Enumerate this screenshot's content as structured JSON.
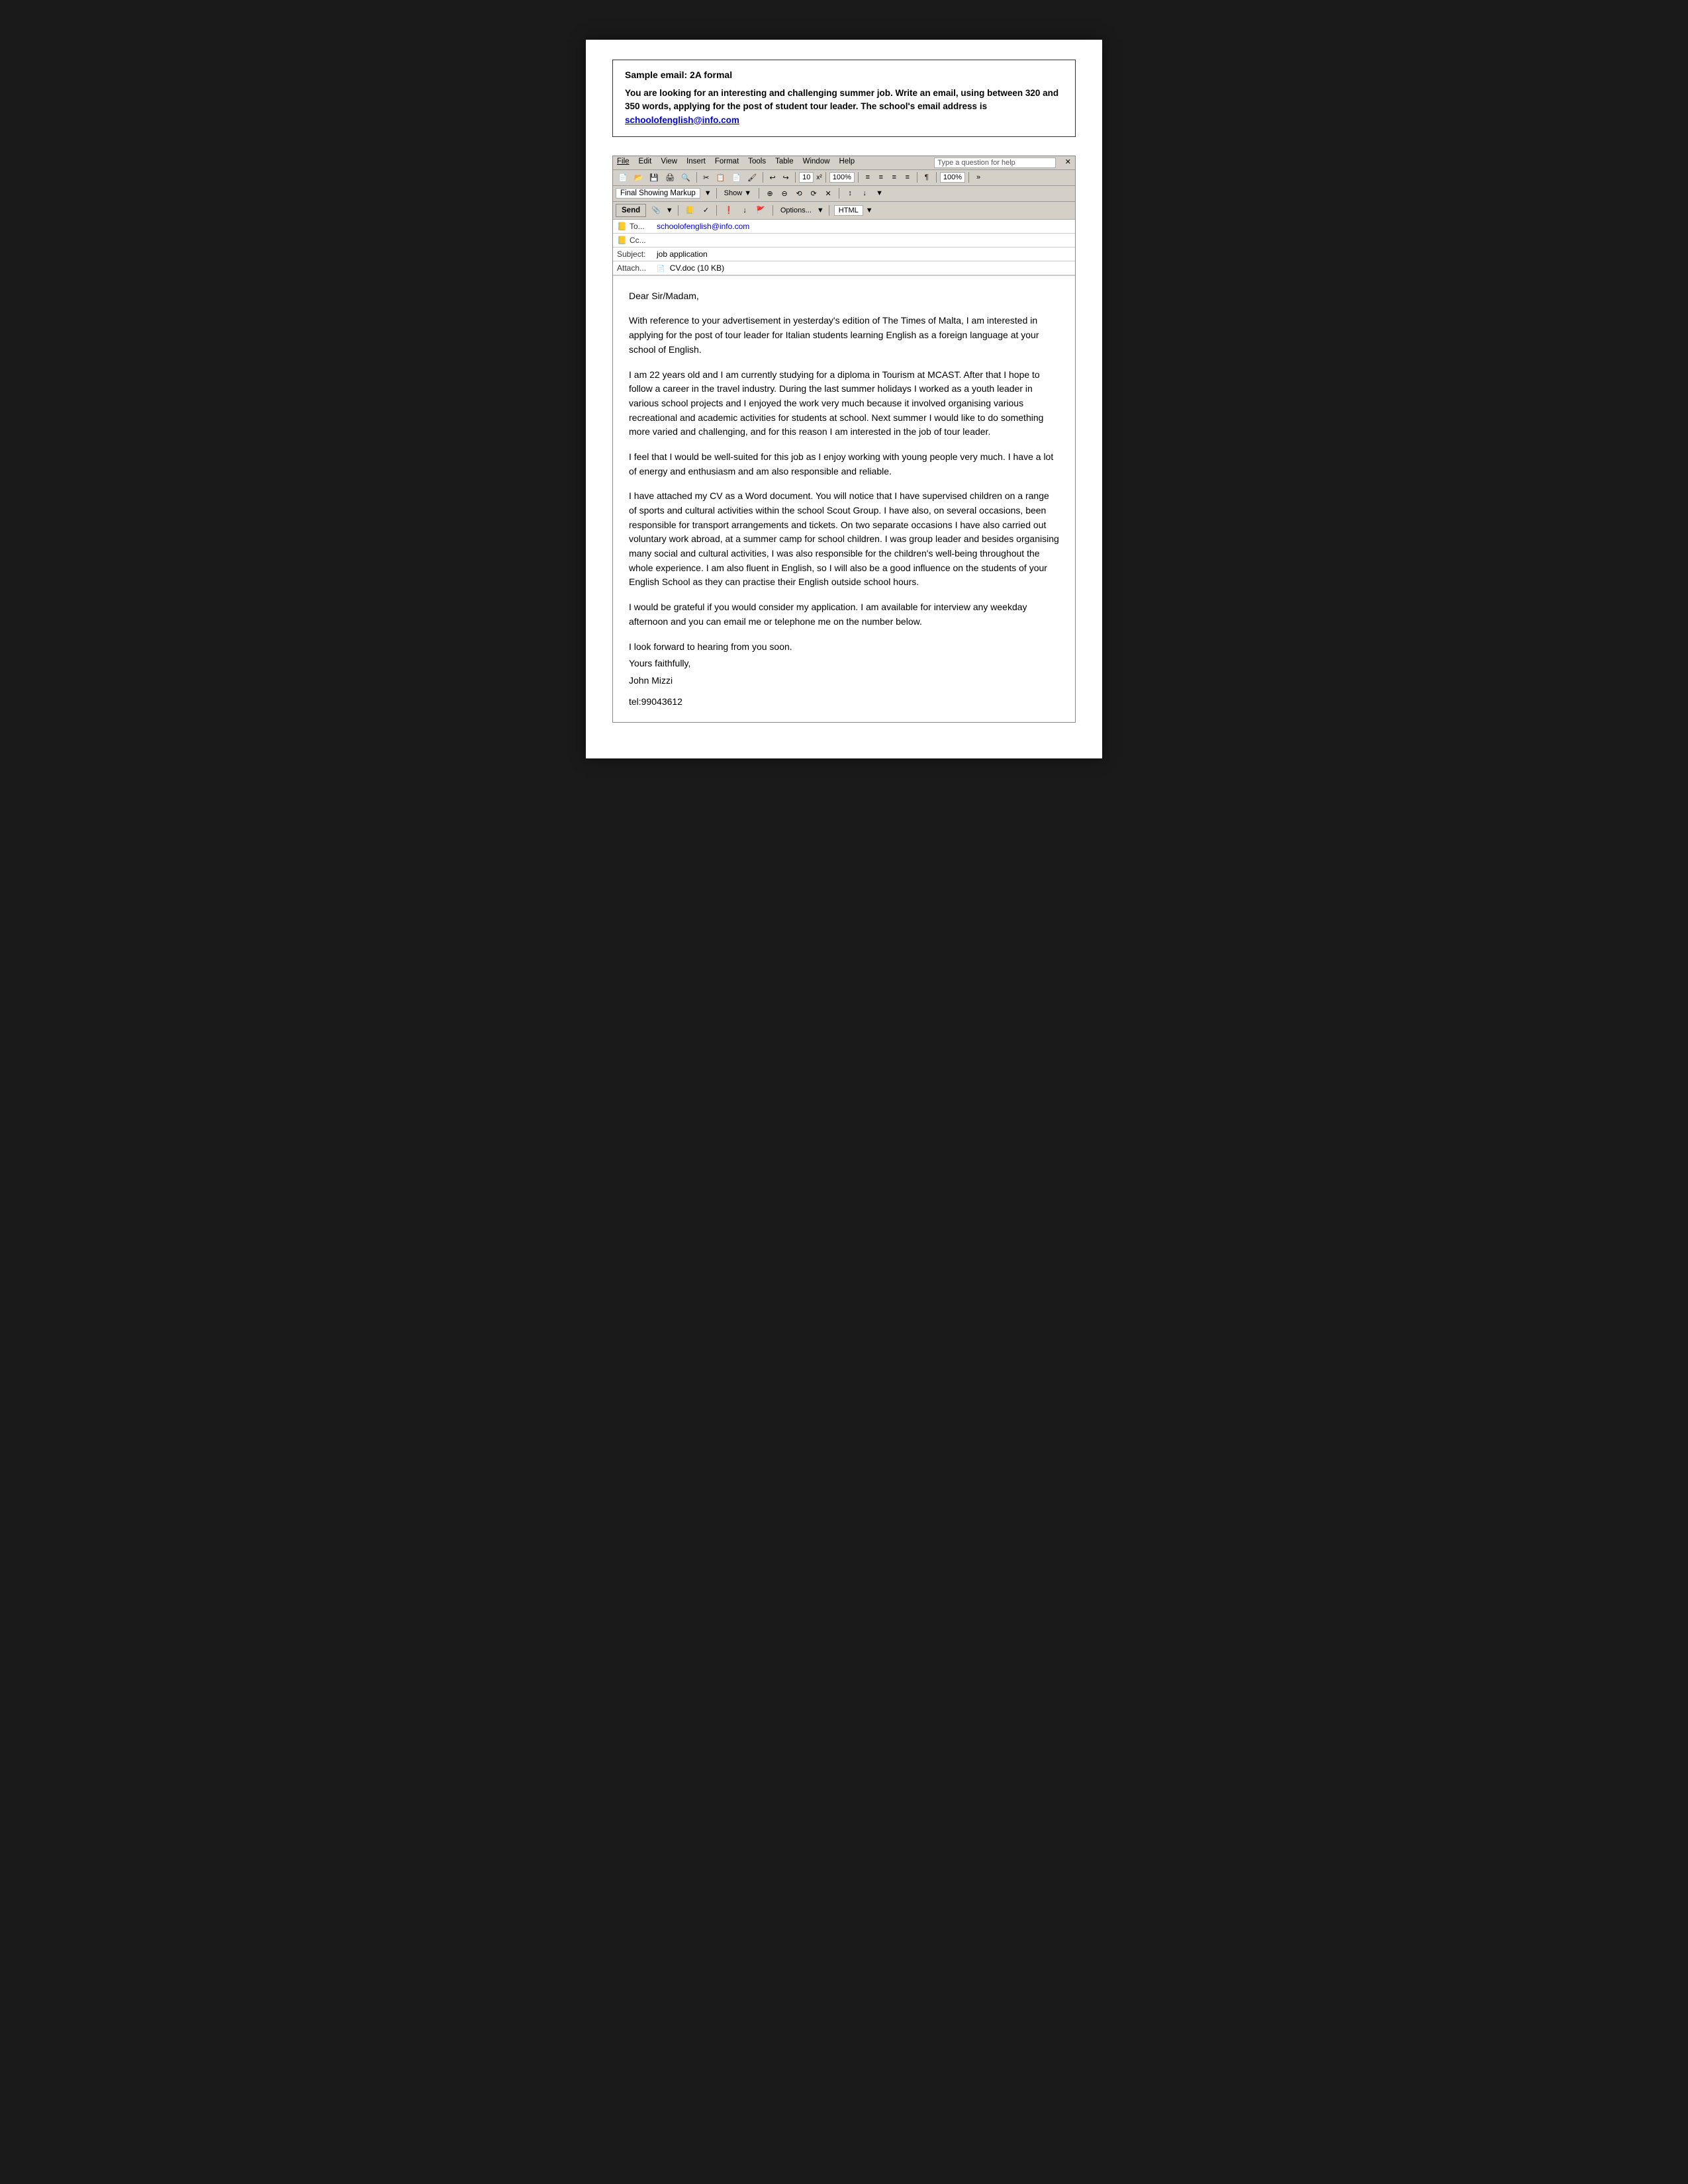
{
  "sample": {
    "title": "Sample email: 2A formal",
    "prompt": "You are looking for an interesting and challenging summer job.  Write an email, using between 320 and 350 words, applying for the post of student tour leader.  The school's email address is ",
    "email_link": "schoolofenglish@info.com"
  },
  "email_client": {
    "menu": {
      "file": "File",
      "edit": "Edit",
      "view": "View",
      "insert": "Insert",
      "format": "Format",
      "tools": "Tools",
      "table": "Table",
      "window": "Window",
      "help": "Help"
    },
    "help_placeholder": "Type a question for help",
    "toolbar1": {
      "buttons": [
        "🖫",
        "🖨",
        "📄",
        "✂",
        "📋",
        "🔍",
        "↩",
        "↪",
        "10",
        "x²",
        "100%",
        "≡",
        "≡",
        "≡",
        "≡",
        "¶",
        "100%"
      ]
    },
    "format_toolbar": {
      "markup_label": "Final Showing Markup",
      "show_label": "Show ▼"
    },
    "compose_toolbar": {
      "send_label": "Send",
      "options_label": "Options...",
      "format_label": "HTML"
    },
    "fields": {
      "to_label": "To...",
      "to_value": "schoolofenglish@info.com",
      "cc_label": "Cc...",
      "cc_value": "",
      "subject_label": "Subject:",
      "subject_value": "job application",
      "attach_label": "Attach...",
      "attach_value": "CV.doc (10 KB)"
    }
  },
  "email_body": {
    "salutation": "Dear Sir/Madam,",
    "paragraph1": "With reference to your advertisement in yesterday's edition of The Times of Malta, I am interested in applying for the post of tour leader for Italian students learning English as a foreign language at your school of English.",
    "paragraph2": "I am 22 years old and I am currently studying for a diploma in Tourism at  MCAST. After that I hope to follow a career in the travel industry. During the last summer holidays I worked as a youth leader in various school projects and I enjoyed the work very much because it involved organising various recreational and academic activities for students at school. Next summer I would like to do something more varied and challenging, and for this reason I am interested in the job of tour leader.",
    "paragraph3": "I feel that I would be well-suited for this job as I enjoy working with young people very much. I have a lot of energy and enthusiasm and am also responsible and reliable.",
    "paragraph4": "I have attached my CV as a Word document. You will notice that I have supervised children on a range of sports and cultural activities within the school Scout Group. I have also, on several occasions, been responsible for transport arrangements and tickets.  On two separate occasions I have also carried out voluntary work abroad, at a summer camp for school children.  I was group leader and besides organising many social and cultural activities, I was also responsible for the children's well-being throughout the whole experience.  I am also fluent in English, so I will also be a good influence on the students of your English School as they can practise their English outside school hours.",
    "paragraph5": "I would be grateful if you would consider my application. I am available for interview any weekday afternoon and you can email me or telephone me on the number below.",
    "closing_line1": "I look forward to hearing from you soon.",
    "closing_line2": "Yours faithfully,",
    "closing_line3": "John Mizzi",
    "tel": "tel:99043612"
  }
}
